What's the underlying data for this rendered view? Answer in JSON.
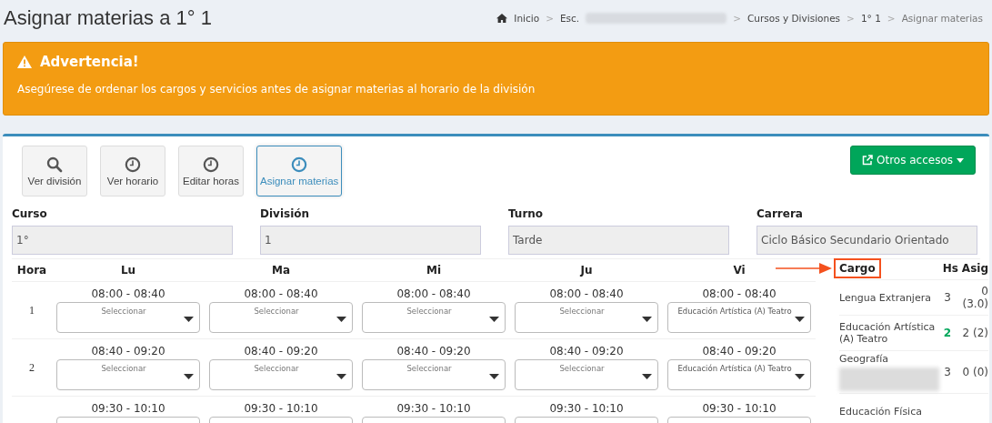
{
  "page_title": "Asignar materias a 1° 1",
  "breadcrumb": [
    {
      "label": "Inicio",
      "kind": "home"
    },
    {
      "sep": ">",
      "label": "Esc.",
      "kind": "redacted"
    },
    {
      "sep": ">",
      "label": "Cursos y Divisiones",
      "kind": "link"
    },
    {
      "sep": ">",
      "label": "1° 1",
      "kind": "link"
    },
    {
      "sep": ">",
      "label": "Asignar materias",
      "kind": "current"
    }
  ],
  "alert": {
    "title": "Advertencia!",
    "message": "Asegúrese de ordenar los cargos y servicios antes de asignar materias al horario de la división"
  },
  "toolbar": [
    {
      "label": "Ver división",
      "selected": false
    },
    {
      "label": "Ver horario",
      "selected": false
    },
    {
      "label": "Editar horas",
      "selected": false
    },
    {
      "label": "Asignar materias",
      "selected": true
    }
  ],
  "other_access_button": "Otros accesos",
  "fields": [
    {
      "label": "Curso",
      "value": "1°"
    },
    {
      "label": "División",
      "value": "1"
    },
    {
      "label": "Turno",
      "value": "Tarde"
    },
    {
      "label": "Carrera",
      "value": "Ciclo Básico Secundario Orientado"
    }
  ],
  "timetable": {
    "columns": [
      "Hora",
      "Lu",
      "Ma",
      "Mi",
      "Ju",
      "Vi"
    ],
    "rows": [
      {
        "hora": "1",
        "slots": [
          {
            "time": "08:00 - 08:40",
            "placeholder": "Seleccionar"
          },
          {
            "time": "08:00 - 08:40",
            "placeholder": "Seleccionar"
          },
          {
            "time": "08:00 - 08:40",
            "placeholder": "Seleccionar"
          },
          {
            "time": "08:00 - 08:40",
            "placeholder": "Seleccionar"
          },
          {
            "time": "08:00 - 08:40",
            "value": "Educación Artística (A) Teatro"
          }
        ]
      },
      {
        "hora": "2",
        "slots": [
          {
            "time": "08:40 - 09:20",
            "placeholder": "Seleccionar"
          },
          {
            "time": "08:40 - 09:20",
            "placeholder": "Seleccionar"
          },
          {
            "time": "08:40 - 09:20",
            "placeholder": "Seleccionar"
          },
          {
            "time": "08:40 - 09:20",
            "placeholder": "Seleccionar"
          },
          {
            "time": "08:40 - 09:20",
            "value": "Educación Artística (A) Teatro"
          }
        ]
      },
      {
        "slots": [
          {
            "time": "09:30 - 10:10"
          },
          {
            "time": "09:30 - 10:10"
          },
          {
            "time": "09:30 - 10:10"
          },
          {
            "time": "09:30 - 10:10"
          },
          {
            "time": "09:30 - 10:10"
          }
        ]
      }
    ]
  },
  "cargos": {
    "columns": [
      {
        "label": "Cargo",
        "highlighted": true
      },
      {
        "label": "Hs",
        "highlighted": false
      },
      {
        "label": "Asig",
        "highlighted": false
      }
    ],
    "rows": [
      {
        "name": "Lengua Extranjera",
        "redacted": false,
        "hs": "3",
        "hs_complete": false,
        "asig": "0 (3.0)"
      },
      {
        "name": "Educación Artística (A) Teatro",
        "redacted": false,
        "hs": "2",
        "hs_complete": true,
        "asig": "2 (2)"
      },
      {
        "name": "Geografía",
        "redacted": true,
        "hs": "3",
        "hs_complete": false,
        "asig": "0 (0)"
      },
      {
        "name": "Educación Física",
        "redacted": false
      }
    ]
  }
}
